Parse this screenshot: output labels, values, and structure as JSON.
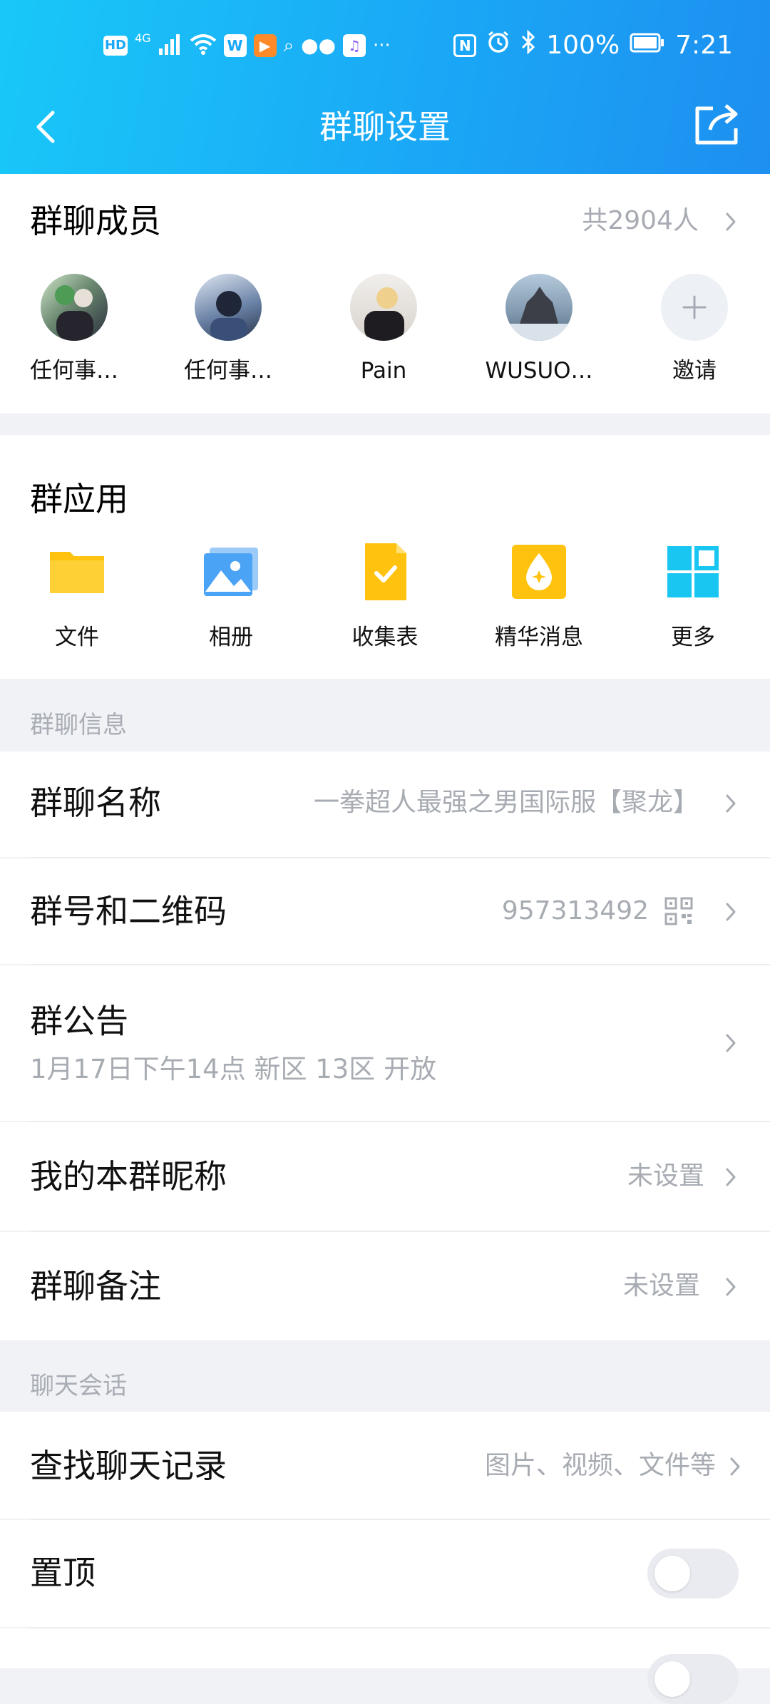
{
  "statusbar": {
    "network": "4G",
    "battery": "100%",
    "time": "7:21"
  },
  "nav": {
    "title": "群聊设置"
  },
  "members": {
    "title": "群聊成员",
    "count": "共2904人",
    "list": [
      {
        "name": "任何事…"
      },
      {
        "name": "任何事…"
      },
      {
        "name": "Pain"
      },
      {
        "name": "WUSUO…"
      }
    ],
    "invite_label": "邀请"
  },
  "apps": {
    "title": "群应用",
    "items": [
      {
        "label": "文件",
        "icon": "folder-icon"
      },
      {
        "label": "相册",
        "icon": "album-icon"
      },
      {
        "label": "收集表",
        "icon": "form-icon"
      },
      {
        "label": "精华消息",
        "icon": "essence-icon"
      },
      {
        "label": "更多",
        "icon": "grid-icon"
      }
    ]
  },
  "info": {
    "section_label": "群聊信息",
    "name_title": "群聊名称",
    "name_value": "一拳超人最强之男国际服【聚龙】",
    "id_title": "群号和二维码",
    "id_value": "957313492",
    "notice_title": "群公告",
    "notice_value": "1月17日下午14点 新区 13区 开放",
    "nickname_title": "我的本群昵称",
    "nickname_value": "未设置",
    "remark_title": "群聊备注",
    "remark_value": "未设置"
  },
  "chat": {
    "section_label": "聊天会话",
    "search_title": "查找聊天记录",
    "search_value": "图片、视频、文件等",
    "pin_title": "置顶",
    "pin_on": false
  },
  "colors": {
    "accent": "#1aa8f6",
    "muted_text": "#a7abb2",
    "folder": "#ffc30f",
    "album": "#4aa3f5",
    "grid": "#19c6f1"
  }
}
